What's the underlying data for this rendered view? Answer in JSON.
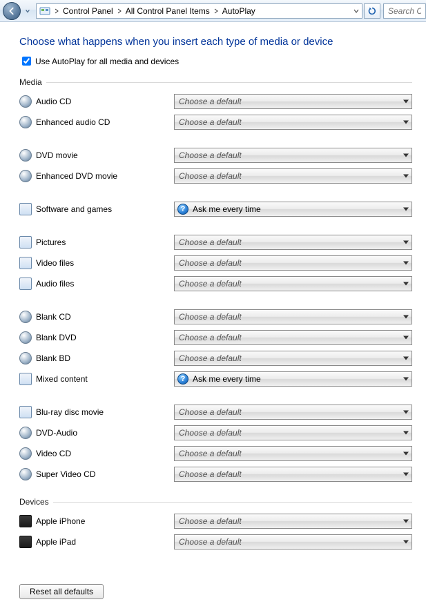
{
  "breadcrumb": {
    "items": [
      "Control Panel",
      "All Control Panel Items",
      "AutoPlay"
    ]
  },
  "search": {
    "placeholder": "Search C"
  },
  "title": "Choose what happens when you insert each type of media or device",
  "use_all": {
    "label": "Use AutoPlay for all media and devices",
    "checked": true
  },
  "default_option": "Choose a default",
  "ask_option": "Ask me every time",
  "sections": [
    {
      "name": "Media",
      "groups": [
        [
          {
            "label": "Audio CD",
            "icon": "disc",
            "value": "default"
          },
          {
            "label": "Enhanced audio CD",
            "icon": "disc",
            "value": "default"
          }
        ],
        [
          {
            "label": "DVD movie",
            "icon": "disc",
            "value": "default"
          },
          {
            "label": "Enhanced DVD movie",
            "icon": "disc",
            "value": "default"
          }
        ],
        [
          {
            "label": "Software and games",
            "icon": "square",
            "value": "ask"
          }
        ],
        [
          {
            "label": "Pictures",
            "icon": "square",
            "value": "default"
          },
          {
            "label": "Video files",
            "icon": "square",
            "value": "default"
          },
          {
            "label": "Audio files",
            "icon": "square",
            "value": "default"
          }
        ],
        [
          {
            "label": "Blank CD",
            "icon": "disc",
            "value": "default"
          },
          {
            "label": "Blank DVD",
            "icon": "disc",
            "value": "default"
          },
          {
            "label": "Blank BD",
            "icon": "disc",
            "value": "default"
          },
          {
            "label": "Mixed content",
            "icon": "square",
            "value": "ask"
          }
        ],
        [
          {
            "label": "Blu-ray disc movie",
            "icon": "square",
            "value": "default"
          },
          {
            "label": "DVD-Audio",
            "icon": "disc",
            "value": "default"
          },
          {
            "label": "Video CD",
            "icon": "disc",
            "value": "default"
          },
          {
            "label": "Super Video CD",
            "icon": "disc",
            "value": "default"
          }
        ]
      ]
    },
    {
      "name": "Devices",
      "groups": [
        [
          {
            "label": "Apple iPhone",
            "icon": "device",
            "value": "default"
          },
          {
            "label": "Apple iPad",
            "icon": "device",
            "value": "default"
          }
        ]
      ]
    }
  ],
  "reset_label": "Reset all defaults"
}
